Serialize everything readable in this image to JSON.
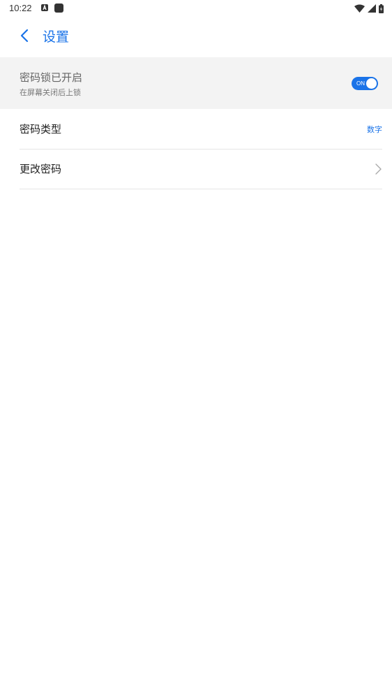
{
  "status_bar": {
    "time": "10:22",
    "notification_icons": [
      "a-notification-icon",
      "square-notification-icon"
    ],
    "system_icons": [
      "wifi-icon",
      "cellular-signal-icon",
      "battery-icon"
    ]
  },
  "header": {
    "title": "设置",
    "back_icon": "chevron-left-icon"
  },
  "lock": {
    "title": "密码锁已开启",
    "subtitle": "在屏幕关闭后上锁",
    "toggle_label": "ON",
    "enabled": true
  },
  "settings": {
    "password_type": {
      "label": "密码类型",
      "value": "数字"
    },
    "change_password": {
      "label": "更改密码",
      "icon": "chevron-right-icon"
    }
  },
  "colors": {
    "accent": "#1a73e8",
    "highlight_background": "#f3f3f3"
  }
}
